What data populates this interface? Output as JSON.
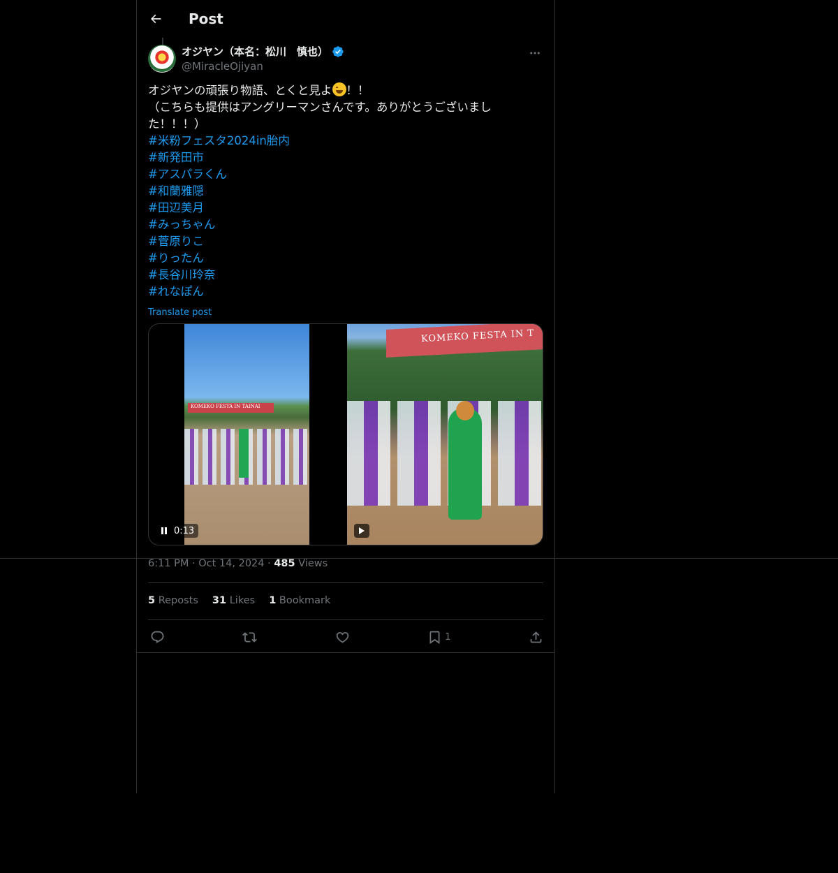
{
  "header": {
    "title": "Post"
  },
  "author": {
    "display_name": "オジヤン（本名：松川　慎也）",
    "handle": "@MiracleOjiyan",
    "verified": true
  },
  "tweet": {
    "line1_before_emoji": "オジヤンの頑張り物語、とくと見よ",
    "line1_after_emoji": "！！",
    "line2": "（こちらも提供はアングリーマンさんです。ありがとうございまし",
    "line3": "た！！！）",
    "emoji": "grinning-sweat-emoji",
    "hashtags": [
      "#米粉フェスタ2024in胎内",
      "#新発田市",
      "#アスパラくん",
      "#和蘭雅隠",
      "#田辺美月",
      "#みっちゃん",
      "#菅原りこ",
      "#りったん",
      "#長谷川玲奈",
      "#れなぽん"
    ],
    "translate_label": "Translate post"
  },
  "media": {
    "video1_time": "0:13",
    "banner_small": "KOMEKO FESTA IN TAINAI",
    "banner_large": "KOMEKO FESTA IN T"
  },
  "meta": {
    "time_date": "6:11 PM · Oct 14, 2024 · ",
    "views_count": "485",
    "views_label": " Views"
  },
  "stats": {
    "reposts_count": "5",
    "reposts_label": " Reposts",
    "likes_count": "31",
    "likes_label": " Likes",
    "bookmarks_count": "1",
    "bookmarks_label": " Bookmark"
  },
  "actions": {
    "bookmark_count": "1"
  },
  "colors": {
    "accent": "#1d9bf0",
    "text": "#e7e9ea",
    "muted": "#71767b",
    "border": "#2f3336",
    "background": "#000000"
  }
}
